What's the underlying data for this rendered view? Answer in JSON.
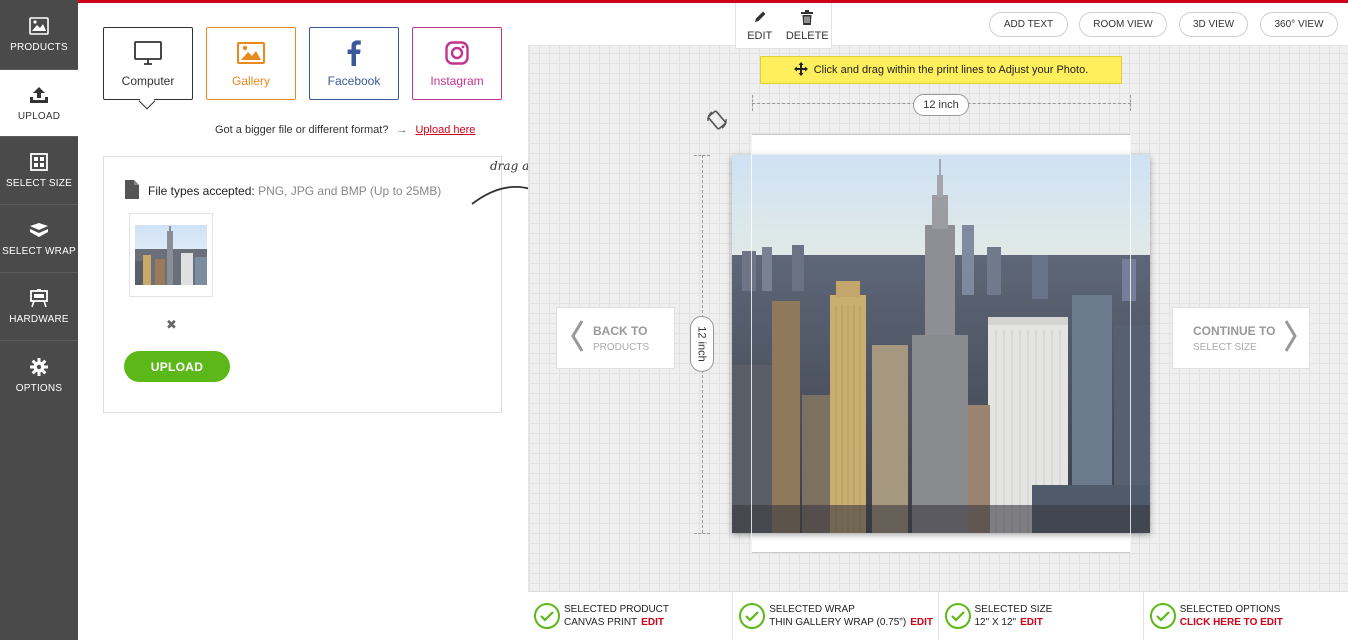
{
  "sidebar": {
    "items": [
      {
        "label": "PRODUCTS",
        "icon": "image-icon"
      },
      {
        "label": "UPLOAD",
        "icon": "upload-icon"
      },
      {
        "label": "SELECT SIZE",
        "icon": "grid-icon"
      },
      {
        "label": "SELECT WRAP",
        "icon": "wrap-icon"
      },
      {
        "label": "HARDWARE",
        "icon": "easel-icon"
      },
      {
        "label": "OPTIONS",
        "icon": "gear-icon"
      }
    ],
    "active_index": 1
  },
  "sources": {
    "computer": "Computer",
    "gallery": "Gallery",
    "facebook": "Facebook",
    "instagram": "Instagram"
  },
  "bigger_file": {
    "text": "Got a bigger file or different format?",
    "link": "Upload here"
  },
  "drop_box": {
    "file_types_label": "File types accepted:",
    "file_types_value": "PNG, JPG and BMP (Up to 25MB)",
    "remove": "✖",
    "upload_button": "UPLOAD"
  },
  "drag_drop_hint": "drag and drop",
  "edit_bar": {
    "edit": "EDIT",
    "delete": "DELETE"
  },
  "views": [
    "ADD TEXT",
    "ROOM VIEW",
    "3D VIEW",
    "360° VIEW"
  ],
  "adjust_hint": "Click and drag within the print lines to Adjust your Photo.",
  "dimensions": {
    "width": "12 inch",
    "height": "12 inch"
  },
  "nav": {
    "back_title": "BACK TO",
    "back_sub": "PRODUCTS",
    "next_title": "CONTINUE TO",
    "next_sub": "SELECT SIZE"
  },
  "footer": [
    {
      "title": "SELECTED PRODUCT",
      "value": "CANVAS PRINT",
      "edit": "EDIT"
    },
    {
      "title": "SELECTED WRAP",
      "value": "THIN GALLERY WRAP (0.75\")",
      "edit": "EDIT"
    },
    {
      "title": "SELECTED SIZE",
      "value": "12\" X 12\"",
      "edit": "EDIT"
    },
    {
      "title": "SELECTED OPTIONS",
      "value": "",
      "edit": "CLICK HERE TO EDIT"
    }
  ],
  "colors": {
    "accent": "#d0021b",
    "green": "#5cb818",
    "sidebar": "#4a4a4a",
    "hint": "#ffef5c"
  }
}
